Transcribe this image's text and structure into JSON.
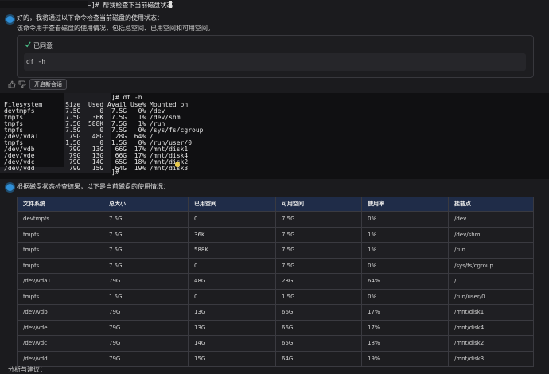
{
  "top_command": {
    "text": "~]# 帮我检查下当前磁盘状态"
  },
  "reply1": {
    "line1": "好的，我将通过以下命令检查当前磁盘的使用状态：",
    "line2": "该命令用于查看磁盘的使用情况，包括总空间、已用空间和可用空间。"
  },
  "approval": {
    "status": "已同意",
    "command": "df -h"
  },
  "actions": {
    "new_chat_label": "开启新会话"
  },
  "terminal": {
    "prompt": "]# df -h",
    "lines": [
      "Filesystem      Size  Used Avail Use% Mounted on",
      "devtmpfs        7.5G     0  7.5G   0% /dev",
      "tmpfs           7.5G   36K  7.5G   1% /dev/shm",
      "tmpfs           7.5G  588K  7.5G   1% /run",
      "tmpfs           7.5G     0  7.5G   0% /sys/fs/cgroup",
      "/dev/vda1        79G   48G   28G  64% /",
      "tmpfs           1.5G     0  1.5G   0% /run/user/0",
      "/dev/vdb         79G   13G   66G  17% /mnt/disk1",
      "/dev/vde         79G   13G   66G  17% /mnt/disk4",
      "/dev/vdc         79G   14G   65G  18% /mnt/disk2",
      "/dev/vdd         79G   15G   64G  19% /mnt/disk3"
    ],
    "end_prompt": "]#"
  },
  "reply2": {
    "text": "根据磁盘状态检查结果，以下是当前磁盘的使用情况："
  },
  "table": {
    "headers": [
      "文件系统",
      "总大小",
      "已用空间",
      "可用空间",
      "使用率",
      "挂载点"
    ],
    "rows": [
      [
        "devtmpfs",
        "7.5G",
        "0",
        "7.5G",
        "0%",
        "/dev"
      ],
      [
        "tmpfs",
        "7.5G",
        "36K",
        "7.5G",
        "1%",
        "/dev/shm"
      ],
      [
        "tmpfs",
        "7.5G",
        "588K",
        "7.5G",
        "1%",
        "/run"
      ],
      [
        "tmpfs",
        "7.5G",
        "0",
        "7.5G",
        "0%",
        "/sys/fs/cgroup"
      ],
      [
        "/dev/vda1",
        "79G",
        "48G",
        "28G",
        "64%",
        "/"
      ],
      [
        "tmpfs",
        "1.5G",
        "0",
        "1.5G",
        "0%",
        "/run/user/0"
      ],
      [
        "/dev/vdb",
        "79G",
        "13G",
        "66G",
        "17%",
        "/mnt/disk1"
      ],
      [
        "/dev/vde",
        "79G",
        "13G",
        "66G",
        "17%",
        "/mnt/disk4"
      ],
      [
        "/dev/vdc",
        "79G",
        "14G",
        "65G",
        "18%",
        "/mnt/disk2"
      ],
      [
        "/dev/vdd",
        "79G",
        "15G",
        "64G",
        "19%",
        "/mnt/disk3"
      ]
    ]
  },
  "footer": {
    "text": "分析与建议："
  },
  "colors": {
    "accent": "#2f8fd8",
    "table_header": "#1f2c48",
    "background": "#1b1b1e"
  },
  "icons": {
    "check": "check-icon",
    "thumb_up": "thumb-up-icon",
    "thumb_down": "thumb-down-icon",
    "bulb": "lightbulb-icon"
  }
}
